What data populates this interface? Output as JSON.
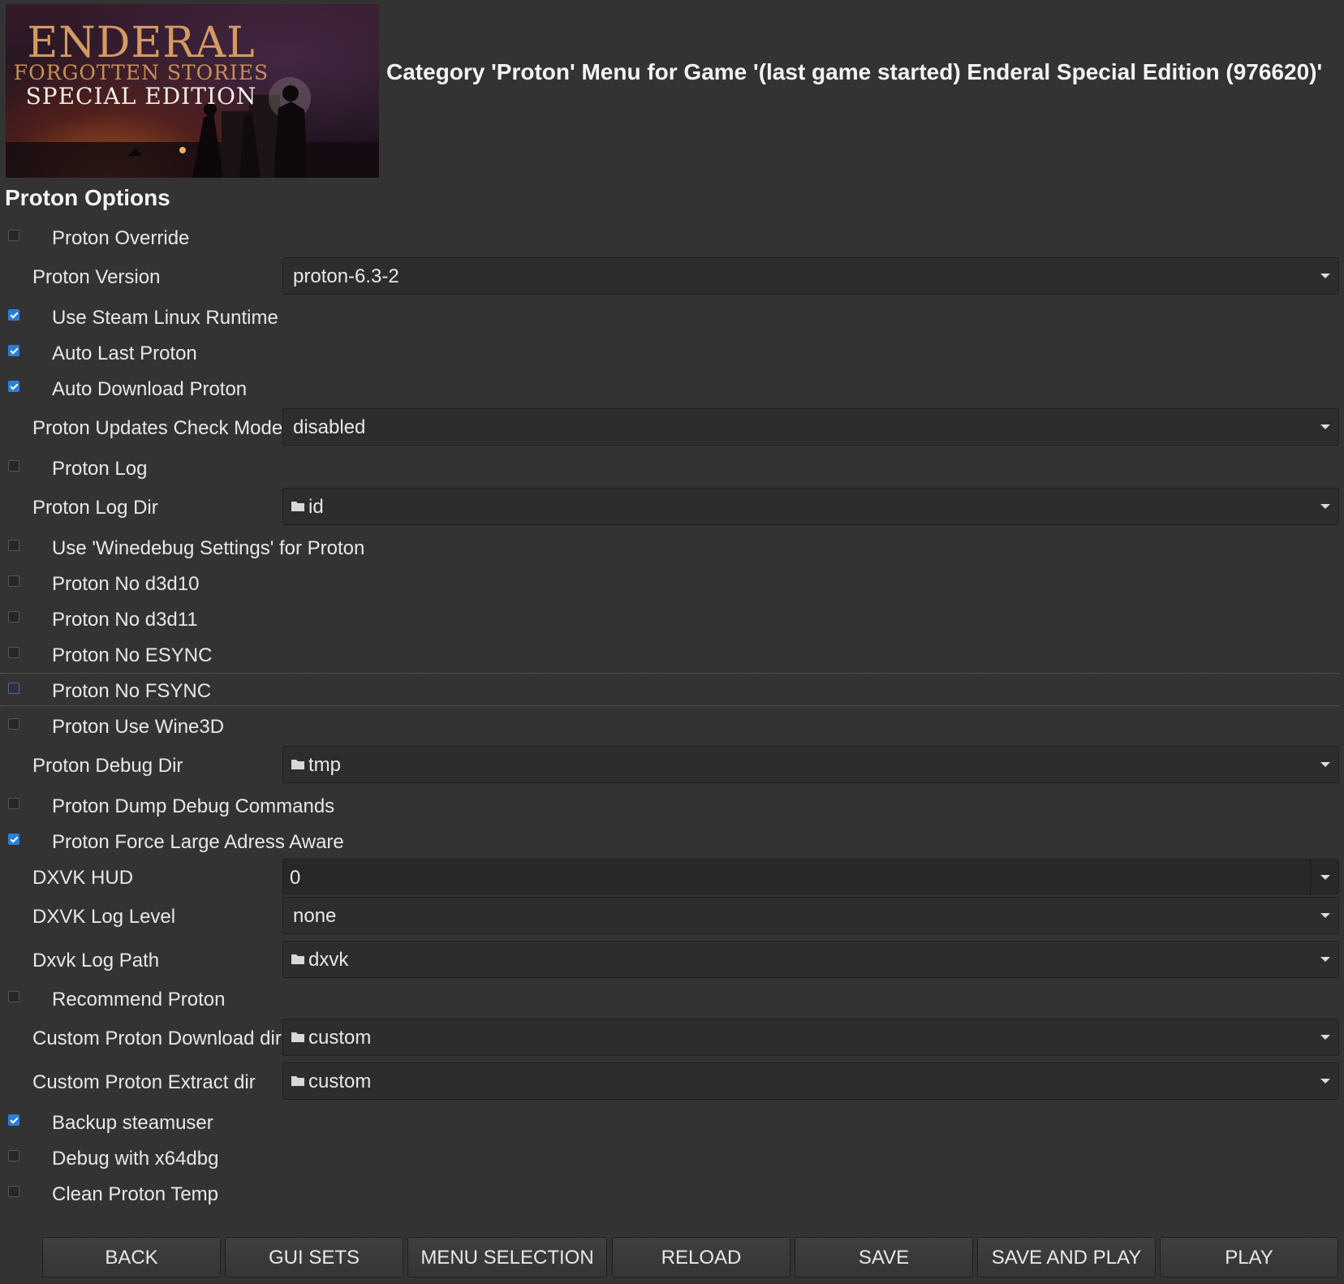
{
  "banner": {
    "line1": "ENDERAL",
    "line2": "FORGOTTEN STORIES",
    "line3": "SPECIAL EDITION"
  },
  "header": {
    "title": "Category 'Proton' Menu for Game '(last game started) Enderal Special Edition (976620)'"
  },
  "section": {
    "title": "Proton Options"
  },
  "options": {
    "proton_override": {
      "label": "Proton Override",
      "checked": false
    },
    "proton_version": {
      "label": "Proton Version",
      "value": "proton-6.3-2"
    },
    "use_steam_linux_runtime": {
      "label": "Use Steam Linux Runtime",
      "checked": true
    },
    "auto_last_proton": {
      "label": "Auto Last Proton",
      "checked": true
    },
    "auto_download_proton": {
      "label": "Auto Download Proton",
      "checked": true
    },
    "proton_updates_check_mode": {
      "label": "Proton Updates Check Mode",
      "value": "disabled"
    },
    "proton_log": {
      "label": "Proton Log",
      "checked": false
    },
    "proton_log_dir": {
      "label": "Proton Log Dir",
      "value": "id"
    },
    "use_winedebug": {
      "label": "Use 'Winedebug Settings' for Proton",
      "checked": false
    },
    "no_d3d10": {
      "label": "Proton No d3d10",
      "checked": false
    },
    "no_d3d11": {
      "label": "Proton No d3d11",
      "checked": false
    },
    "no_esync": {
      "label": "Proton No ESYNC",
      "checked": false
    },
    "no_fsync": {
      "label": "Proton No FSYNC",
      "checked": false
    },
    "use_wine3d": {
      "label": "Proton Use Wine3D",
      "checked": false
    },
    "proton_debug_dir": {
      "label": "Proton Debug Dir",
      "value": "tmp"
    },
    "dump_debug_commands": {
      "label": "Proton Dump Debug Commands",
      "checked": false
    },
    "force_large_address_aware": {
      "label": "Proton Force Large Adress Aware",
      "checked": true
    },
    "dxvk_hud": {
      "label": "DXVK HUD",
      "value": "0"
    },
    "dxvk_log_level": {
      "label": "DXVK Log Level",
      "value": "none"
    },
    "dxvk_log_path": {
      "label": "Dxvk Log Path",
      "value": "dxvk"
    },
    "recommend_proton": {
      "label": "Recommend Proton",
      "checked": false
    },
    "custom_download_dir": {
      "label": "Custom Proton Download dir",
      "value": "custom"
    },
    "custom_extract_dir": {
      "label": "Custom Proton Extract dir",
      "value": "custom"
    },
    "backup_steamuser": {
      "label": "Backup steamuser",
      "checked": true
    },
    "debug_x64dbg": {
      "label": "Debug with x64dbg",
      "checked": false
    },
    "clean_proton_temp": {
      "label": "Clean Proton Temp",
      "checked": false
    }
  },
  "footer": {
    "back": "BACK",
    "gui_sets": "GUI SETS",
    "menu_selection": "MENU SELECTION",
    "reload": "RELOAD",
    "save": "SAVE",
    "save_and_play": "SAVE AND PLAY",
    "play": "PLAY"
  },
  "colors": {
    "background": "#333333",
    "accent_checkbox": "#2a7fd8"
  }
}
